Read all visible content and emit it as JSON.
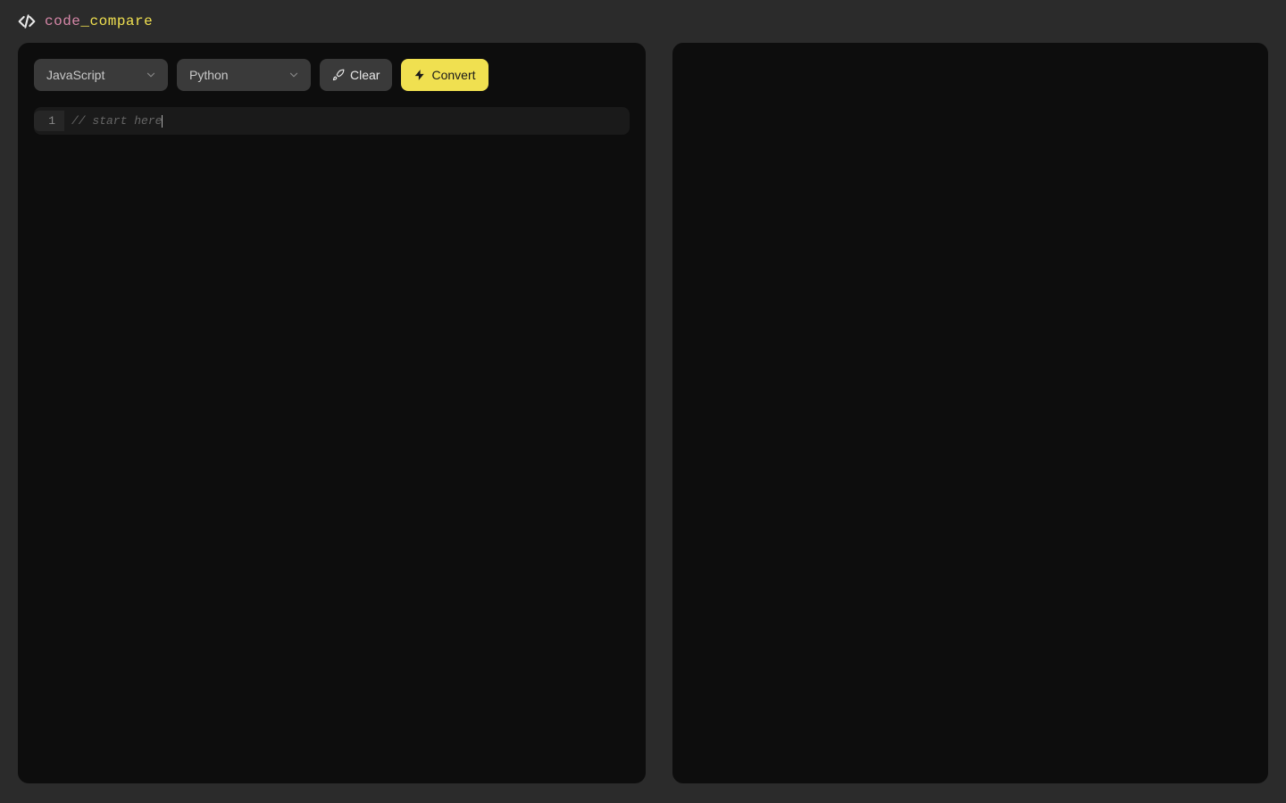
{
  "logo": {
    "code_word": "code",
    "underscore": "_",
    "compare_word": "compare"
  },
  "toolbar": {
    "source_language": "JavaScript",
    "target_language": "Python",
    "clear_label": "Clear",
    "convert_label": "Convert"
  },
  "editor": {
    "line_number": "1",
    "placeholder": "// start here"
  },
  "colors": {
    "accent_yellow": "#f0e050",
    "accent_pink": "#d687a8",
    "bg_dark": "#2b2b2b",
    "panel_dark": "#0d0d0d",
    "button_gray": "#3a3a3a"
  }
}
